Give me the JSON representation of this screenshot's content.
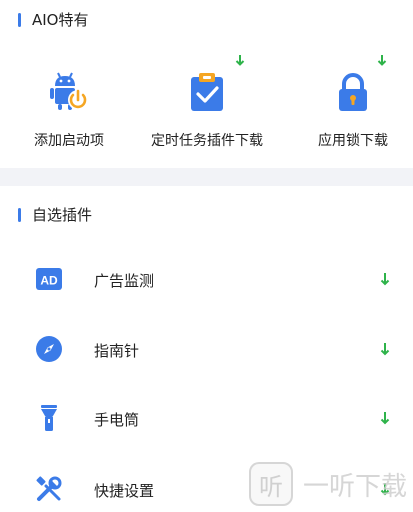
{
  "aio_section": {
    "title": "AIO特有",
    "items": [
      {
        "label": "添加启动项",
        "icon": "android-power-icon",
        "has_download": false
      },
      {
        "label": "定时任务插件下载",
        "icon": "clipboard-check-icon",
        "has_download": true
      },
      {
        "label": "应用锁下载",
        "icon": "lock-icon",
        "has_download": true
      }
    ]
  },
  "plugin_section": {
    "title": "自选插件",
    "items": [
      {
        "label": "广告监测",
        "icon": "ad-icon"
      },
      {
        "label": "指南针",
        "icon": "compass-icon"
      },
      {
        "label": "手电筒",
        "icon": "flashlight-icon"
      },
      {
        "label": "快捷设置",
        "icon": "wrench-screwdriver-icon"
      }
    ]
  },
  "watermark": {
    "icon_text": "听",
    "text": "一听下载"
  },
  "colors": {
    "accent": "#3b7be8",
    "download_green": "#2eb34a",
    "icon_orange": "#f5a623",
    "background": "#f2f3f7"
  }
}
